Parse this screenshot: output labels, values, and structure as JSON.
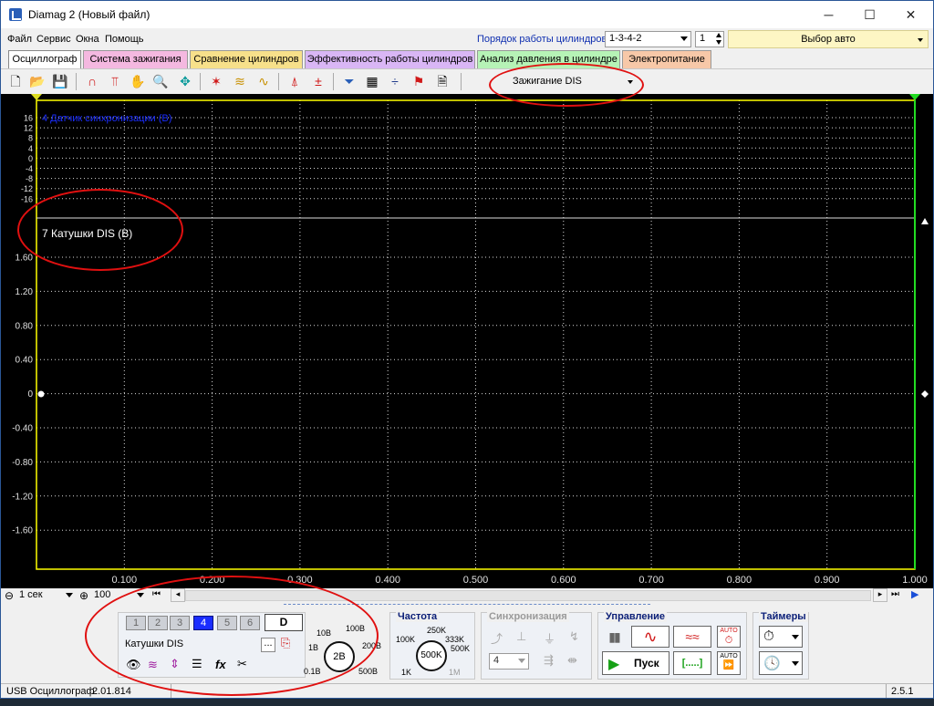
{
  "window": {
    "title": "Diamag 2 (Новый файл)",
    "minimize": "─",
    "maximize": "☐",
    "close": "✕"
  },
  "menu": [
    "Файл",
    "Сервис",
    "Окна",
    "Помощь"
  ],
  "firing_order": {
    "label": "Порядок работы цилиндров",
    "value": "1-3-4-2",
    "cylinder": "1"
  },
  "auto_select": "Выбор авто",
  "tabs": [
    {
      "label": "Осциллограф",
      "color": "#ffffff"
    },
    {
      "label": "Система зажигания",
      "color": "#f4b8e0"
    },
    {
      "label": "Сравнение цилиндров",
      "color": "#f7e08a"
    },
    {
      "label": "Эффективность работы цилиндров",
      "color": "#d9b6f5"
    },
    {
      "label": "Анализ давления в цилиндре",
      "color": "#b6f3b6"
    },
    {
      "label": "Электропитание",
      "color": "#f7c8a8"
    }
  ],
  "mode": "Зажигание DIS",
  "scope": {
    "channel4_label": "4 Датчик синхронизации (В)",
    "channel4_ticks": [
      "16",
      "12",
      "8",
      "4",
      "0",
      "-4",
      "-8",
      "-12",
      "-16"
    ],
    "channel7_label": "7 Катушки DIS (В)",
    "channel7_ticks": [
      "1.60",
      "1.20",
      "0.80",
      "0.40",
      "0",
      "-0.40",
      "-0.80",
      "-1.20",
      "-1.60"
    ],
    "time_ticks": [
      "0.100",
      "0.200",
      "0.300",
      "0.400",
      "0.500",
      "0.600",
      "0.700",
      "0.800",
      "0.900",
      "1.000"
    ],
    "colors": {
      "background": "#000000",
      "grid": "#ffffff",
      "frame": "#ffff00",
      "channel4": "#1a2dff",
      "cursor": "#22dd22"
    }
  },
  "timebase": {
    "scale": "1 сек",
    "zoom": "100"
  },
  "channel_group": {
    "buttons": [
      "1",
      "2",
      "3",
      "4",
      "5",
      "6"
    ],
    "active": "4",
    "d_button": "D",
    "channel_name": "Катушки DIS",
    "dots": "...",
    "range_labels": [
      "10В",
      "100В",
      "1В",
      "200В",
      "0.1В",
      "500В"
    ],
    "range_value": "2В"
  },
  "frequency": {
    "title": "Частота",
    "labels": [
      "250K",
      "100K",
      "333K",
      "500K",
      "1K",
      "1M"
    ],
    "value": "500K"
  },
  "sync": {
    "title": "Синхронизация",
    "channel": "4"
  },
  "control": {
    "title": "Управление",
    "start": "Пуск",
    "bracket": "[.....]",
    "auto1": "AUTO",
    "auto2": "AUTO"
  },
  "timers": {
    "title": "Таймеры"
  },
  "status": {
    "device": "USB Осциллограф",
    "version": "2.01.814",
    "build": "2.5.1"
  }
}
